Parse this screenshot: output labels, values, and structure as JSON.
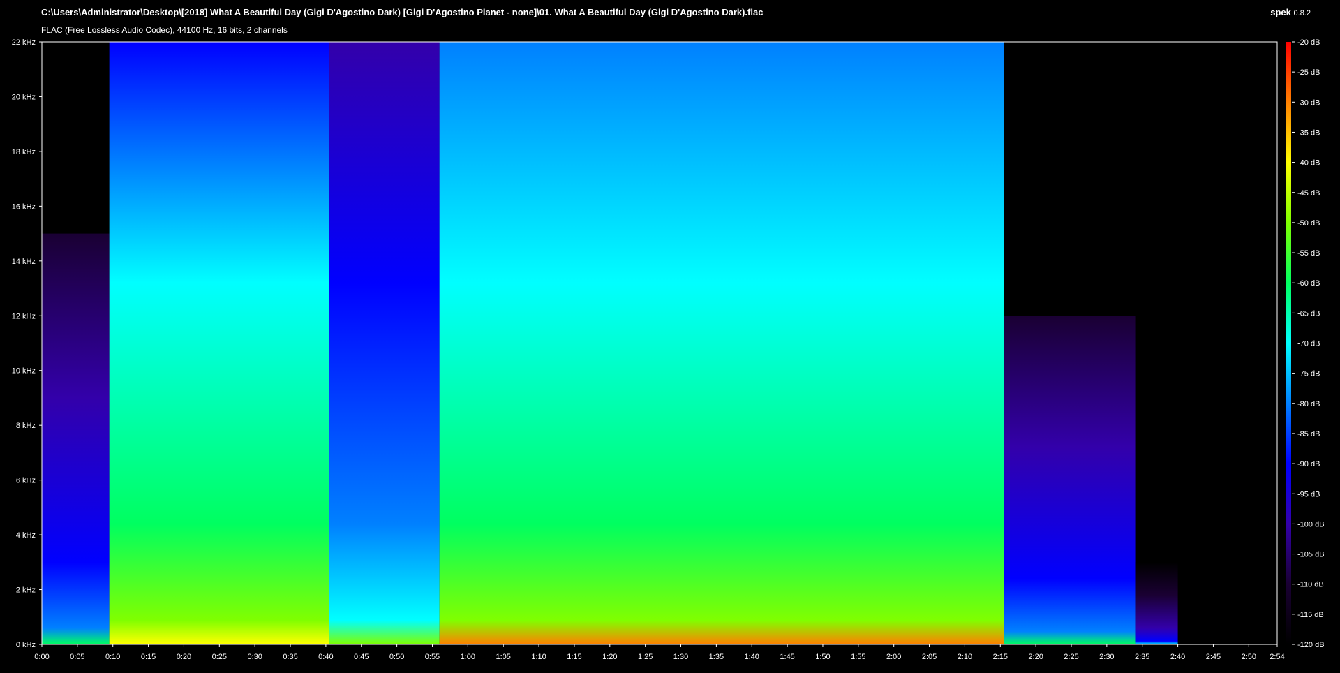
{
  "header": {
    "file_path": "C:\\Users\\Administrator\\Desktop\\[2018] What A Beautiful Day (Gigi D'Agostino Dark) [Gigi D'Agostino Planet - none]\\01. What A Beautiful Day (Gigi D'Agostino Dark).flac",
    "file_info": "FLAC (Free Lossless Audio Codec), 44100 Hz, 16 bits, 2 channels",
    "app_name": "spek",
    "app_version": "0.8.2"
  },
  "chart_data": {
    "type": "heatmap",
    "title": "",
    "xlabel": "",
    "ylabel": "",
    "x_unit": "time (m:ss)",
    "y_unit": "kHz",
    "xlim_seconds": [
      0,
      174
    ],
    "ylim_khz": [
      0,
      22
    ],
    "x_ticks": [
      "0:00",
      "0:05",
      "0:10",
      "0:15",
      "0:20",
      "0:25",
      "0:30",
      "0:35",
      "0:40",
      "0:45",
      "0:50",
      "0:55",
      "1:00",
      "1:05",
      "1:10",
      "1:15",
      "1:20",
      "1:25",
      "1:30",
      "1:35",
      "1:40",
      "1:45",
      "1:50",
      "1:55",
      "2:00",
      "2:05",
      "2:10",
      "2:15",
      "2:20",
      "2:25",
      "2:30",
      "2:35",
      "2:40",
      "2:45",
      "2:50",
      "2:54"
    ],
    "y_ticks": [
      "0 kHz",
      "2 kHz",
      "4 kHz",
      "6 kHz",
      "8 kHz",
      "10 kHz",
      "12 kHz",
      "14 kHz",
      "16 kHz",
      "18 kHz",
      "20 kHz",
      "22 kHz"
    ],
    "colorbar_ticks": [
      "-20 dB",
      "-25 dB",
      "-30 dB",
      "-35 dB",
      "-40 dB",
      "-45 dB",
      "-50 dB",
      "-55 dB",
      "-60 dB",
      "-65 dB",
      "-70 dB",
      "-75 dB",
      "-80 dB",
      "-85 dB",
      "-90 dB",
      "-95 dB",
      "-100 dB",
      "-105 dB",
      "-110 dB",
      "-115 dB",
      "-120 dB"
    ],
    "colorbar_range_db": [
      -120,
      -20
    ],
    "colormap": [
      "#000000",
      "#1a0033",
      "#3300aa",
      "#0000ff",
      "#0080ff",
      "#00ffff",
      "#00ff60",
      "#80ff00",
      "#ffff00",
      "#ff8000",
      "#ff0000"
    ],
    "segments": [
      {
        "t_start": 0,
        "t_end": 9.5,
        "cutoff_khz": 15,
        "level_db": -100
      },
      {
        "t_start": 9.5,
        "t_end": 40.5,
        "cutoff_khz": 22,
        "level_db": -75
      },
      {
        "t_start": 40.5,
        "t_end": 56,
        "cutoff_khz": 22,
        "level_db": -90
      },
      {
        "t_start": 56,
        "t_end": 135.5,
        "cutoff_khz": 22,
        "level_db": -70
      },
      {
        "t_start": 135.5,
        "t_end": 154,
        "cutoff_khz": 12,
        "level_db": -100
      },
      {
        "t_start": 154,
        "t_end": 160,
        "cutoff_khz": 3,
        "level_db": -110
      }
    ],
    "legend": "right colorbar",
    "grid": false
  }
}
